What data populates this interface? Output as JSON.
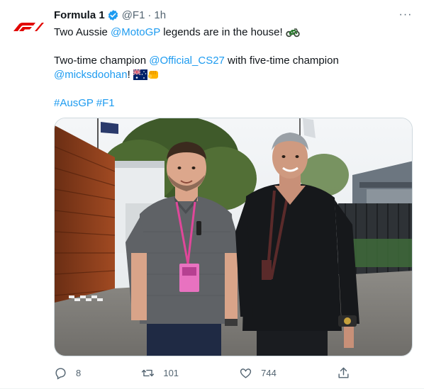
{
  "tweet": {
    "author_name": "Formula 1",
    "handle": "@F1",
    "separator": "·",
    "time": "1h",
    "more_label": "···",
    "line1_prefix": "Two Aussie ",
    "line1_mention": "@MotoGP",
    "line1_suffix": " legends are in the house! ",
    "line2_prefix": "Two-time champion ",
    "line2_mention": "@Official_CS27",
    "line2_suffix": " with five-time champion",
    "line3_mention": "@micksdoohan",
    "line3_suffix": "! ",
    "hashtag1": "#AusGP",
    "hashtag2": "#F1"
  },
  "actions": {
    "reply_count": "8",
    "retweet_count": "101",
    "like_count": "744"
  },
  "icons": {
    "logo": "f1-logo",
    "verified": "verified-badge-icon",
    "motorcycle": "motorcycle-emoji",
    "flag": "australia-flag-emoji",
    "fist": "fist-bump-emoji"
  },
  "colors": {
    "link": "#1d9bf0",
    "f1_red": "#e10600",
    "muted": "#536471"
  }
}
